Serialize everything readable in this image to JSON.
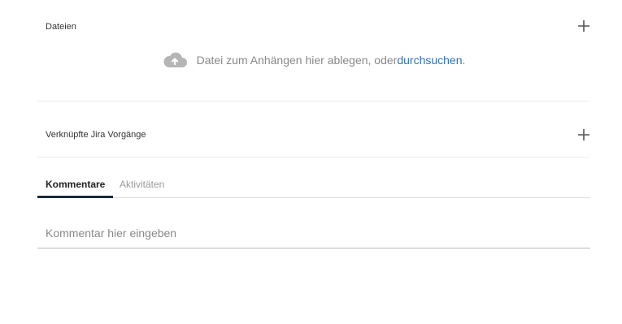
{
  "attachments": {
    "label": "Dateien",
    "add_icon": "plus-icon",
    "dropzone_text": "Datei zum Anhängen hier ablegen, oder ",
    "browse_link": "durchsuchen",
    "trailing": ".",
    "cloud_icon": "cloud-upload-icon"
  },
  "linked_issues": {
    "label": "Verknüpfte Jira Vorgänge",
    "add_icon": "plus-icon"
  },
  "activity": {
    "tabs": [
      {
        "label": "Kommentare",
        "active": true
      },
      {
        "label": "Aktivitäten",
        "active": false
      }
    ],
    "comment_placeholder": "Kommentar hier eingeben"
  },
  "colors": {
    "link": "#3572b0",
    "active_tab_underline": "#1d2b3a",
    "icon_gray": "#b5b5b5"
  }
}
